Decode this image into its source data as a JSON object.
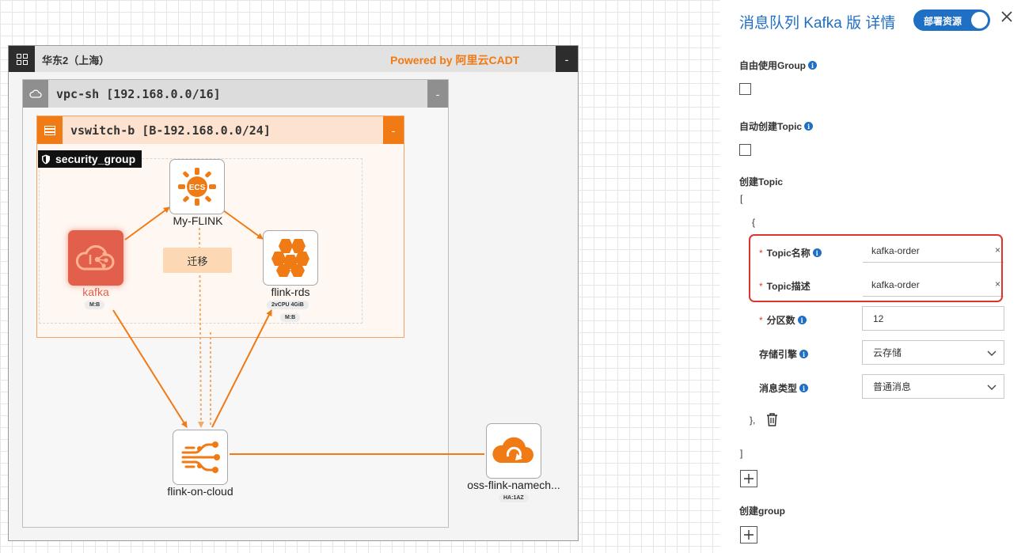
{
  "canvas": {
    "region": {
      "title": "华东2（上海）",
      "powered_by": "Powered by 阿里云CADT",
      "collapse": "-"
    },
    "vpc": {
      "title": "vpc-sh [192.168.0.0/16]",
      "collapse": "-"
    },
    "vswitch": {
      "title": "vswitch-b [B-192.168.0.0/24]",
      "collapse": "-"
    },
    "security_group": {
      "title": "security_group"
    },
    "nodes": {
      "ecs": {
        "label": "My-FLINK",
        "icon_text": "ECS"
      },
      "kafka": {
        "label": "kafka",
        "badge": "M:B"
      },
      "rds": {
        "label": "flink-rds",
        "spec": "2vCPU  4GiB",
        "badge": "M:B"
      },
      "flink": {
        "label": "flink-on-cloud"
      },
      "oss": {
        "label": "oss-flink-namech...",
        "badge": "HA:1AZ"
      }
    },
    "migrate_label": "迁移"
  },
  "panel": {
    "title": "消息队列 Kafka 版 详情",
    "toggle_label": "部署资源",
    "toggle_on": true,
    "close_icon": "close-icon",
    "free_group": {
      "label": "自由使用Group",
      "checked": false
    },
    "auto_topic": {
      "label": "自动创建Topic",
      "checked": false
    },
    "create_topic": {
      "label": "创建Topic",
      "open_bracket": "[",
      "open_brace": "{",
      "topic_name": {
        "label": "Topic名称",
        "value": "kafka-order"
      },
      "topic_desc": {
        "label": "Topic描述",
        "value": "kafka-order"
      },
      "partitions": {
        "label": "分区数",
        "value": "12"
      },
      "storage_engine": {
        "label": "存储引擎",
        "value": "云存储"
      },
      "message_type": {
        "label": "消息类型",
        "value": "普通消息"
      },
      "close_brace": "},",
      "close_bracket": "]"
    },
    "create_group": {
      "label": "创建group"
    },
    "required_mark": "*",
    "clear_mark": "×",
    "accent_color": "#1f6fc5",
    "highlight_color": "#e0332d"
  }
}
